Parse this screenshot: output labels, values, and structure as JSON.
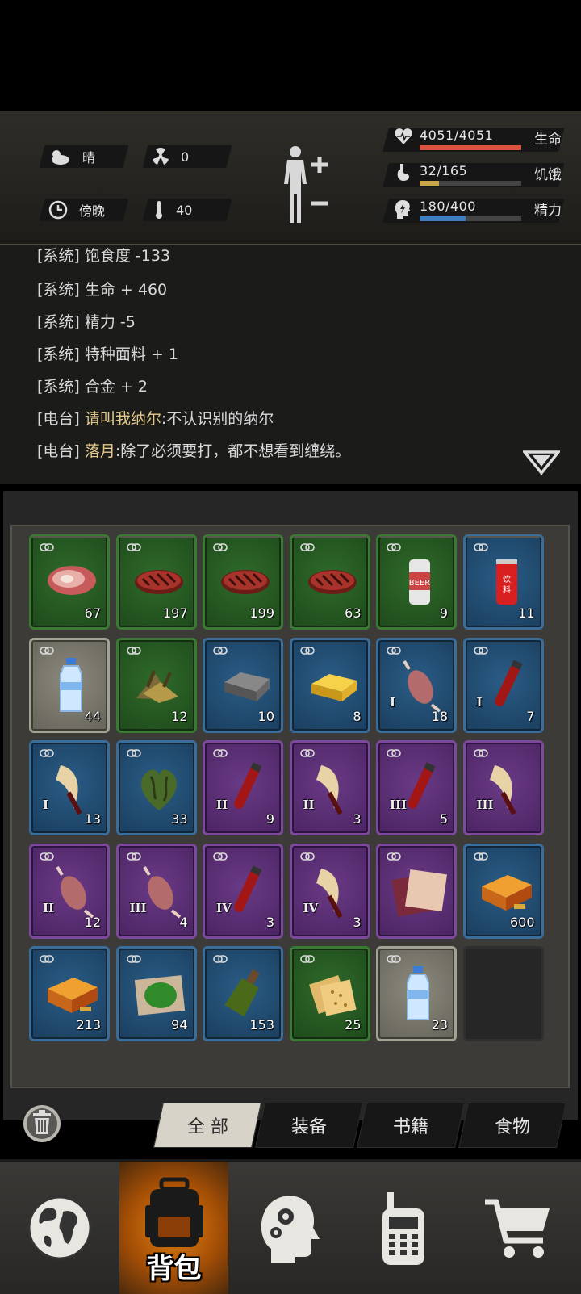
{
  "status": {
    "weather": "晴",
    "radiation": "0",
    "time_of_day": "傍晚",
    "temperature": "40",
    "health": {
      "text": "4051/4051",
      "name": "生命",
      "fraction": 1.0,
      "color": "#d9533f"
    },
    "hunger": {
      "text": "32/165",
      "name": "饥饿",
      "fraction": 0.194,
      "color": "#c9a64a"
    },
    "energy": {
      "text": "180/400",
      "name": "精力",
      "fraction": 0.45,
      "color": "#3d7fc1"
    }
  },
  "log": [
    {
      "tag": "[系统]",
      "text": "饱食度 -133",
      "radio": false
    },
    {
      "tag": "[系统]",
      "text": "生命 + 460",
      "radio": false
    },
    {
      "tag": "[系统]",
      "text": "精力 -5",
      "radio": false
    },
    {
      "tag": "[系统]",
      "text": "特种面料 + 1",
      "radio": false
    },
    {
      "tag": "[系统]",
      "text": "合金 + 2",
      "radio": false
    },
    {
      "tag": "[电台]",
      "sender": "请叫我纳尔",
      "text": ":不认识别的纳尔",
      "radio": true
    },
    {
      "tag": "[电台]",
      "sender": "落月",
      "text": ":除了必须要打，都不想看到缠绕。",
      "radio": true
    }
  ],
  "inventory": [
    {
      "item": "raw-steak",
      "rarity": "green",
      "count": "67",
      "tier": ""
    },
    {
      "item": "cooked-steak",
      "rarity": "green",
      "count": "197",
      "tier": ""
    },
    {
      "item": "cooked-steak",
      "rarity": "green",
      "count": "199",
      "tier": ""
    },
    {
      "item": "cooked-steak",
      "rarity": "green",
      "count": "63",
      "tier": ""
    },
    {
      "item": "beer-can",
      "rarity": "green",
      "count": "9",
      "tier": ""
    },
    {
      "item": "soda-can",
      "rarity": "blue",
      "count": "11",
      "tier": ""
    },
    {
      "item": "water-bottle",
      "rarity": "white",
      "count": "44",
      "tier": ""
    },
    {
      "item": "herb-pile",
      "rarity": "green",
      "count": "12",
      "tier": ""
    },
    {
      "item": "iron-ingot",
      "rarity": "blue",
      "count": "10",
      "tier": ""
    },
    {
      "item": "gold-bar",
      "rarity": "blue",
      "count": "8",
      "tier": ""
    },
    {
      "item": "muscle",
      "rarity": "blue",
      "count": "18",
      "tier": "I"
    },
    {
      "item": "blood-vial",
      "rarity": "blue",
      "count": "7",
      "tier": "I"
    },
    {
      "item": "claw",
      "rarity": "blue",
      "count": "13",
      "tier": "I"
    },
    {
      "item": "heart",
      "rarity": "blue",
      "count": "33",
      "tier": ""
    },
    {
      "item": "blood-vial",
      "rarity": "purple",
      "count": "9",
      "tier": "II"
    },
    {
      "item": "claw",
      "rarity": "purple",
      "count": "3",
      "tier": "II"
    },
    {
      "item": "blood-vial",
      "rarity": "purple",
      "count": "5",
      "tier": "III"
    },
    {
      "item": "claw",
      "rarity": "purple",
      "count": "",
      "tier": "III"
    },
    {
      "item": "muscle",
      "rarity": "purple",
      "count": "12",
      "tier": "II"
    },
    {
      "item": "muscle",
      "rarity": "purple",
      "count": "4",
      "tier": "III"
    },
    {
      "item": "blood-vial",
      "rarity": "purple",
      "count": "3",
      "tier": "IV"
    },
    {
      "item": "claw",
      "rarity": "purple",
      "count": "3",
      "tier": "IV"
    },
    {
      "item": "fabric",
      "rarity": "purple",
      "count": "",
      "tier": ""
    },
    {
      "item": "ammo-box",
      "rarity": "blue",
      "count": "600",
      "tier": ""
    },
    {
      "item": "ammo-box",
      "rarity": "blue",
      "count": "213",
      "tier": ""
    },
    {
      "item": "green-paste",
      "rarity": "blue",
      "count": "94",
      "tier": ""
    },
    {
      "item": "molotov",
      "rarity": "blue",
      "count": "153",
      "tier": ""
    },
    {
      "item": "crackers",
      "rarity": "green",
      "count": "25",
      "tier": ""
    },
    {
      "item": "water-bottle",
      "rarity": "white",
      "count": "23",
      "tier": ""
    },
    {
      "item": "empty",
      "rarity": "empty",
      "count": "",
      "tier": ""
    }
  ],
  "tabs": [
    "全 部",
    "装备",
    "书籍",
    "食物"
  ],
  "nav": {
    "backpack_label": "背包"
  }
}
